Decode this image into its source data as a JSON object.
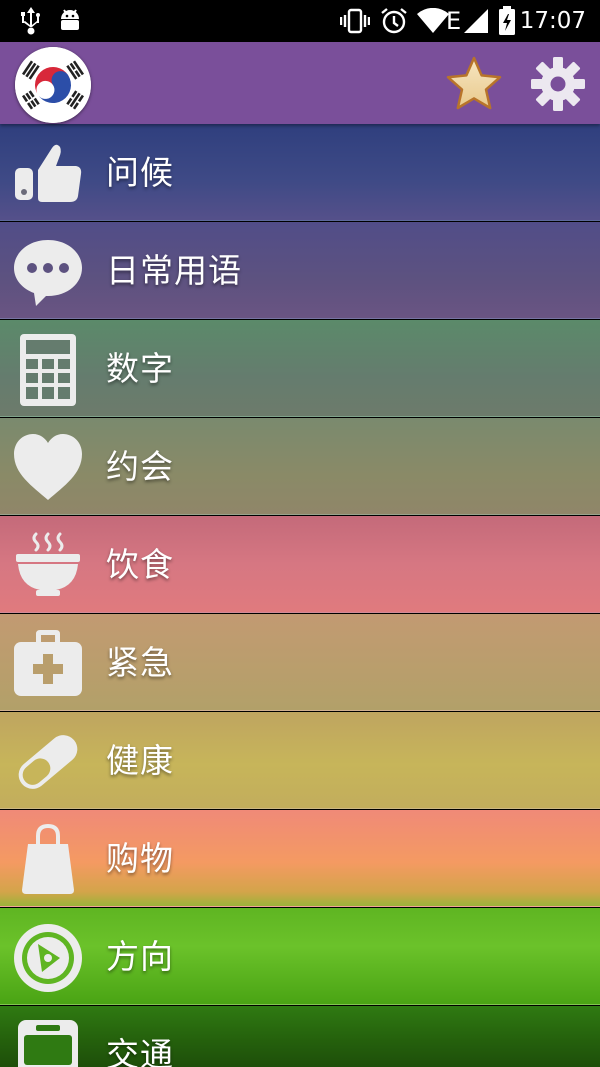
{
  "status_bar": {
    "time": "17:07",
    "left_icons": [
      "usb-icon",
      "android-debug-icon"
    ],
    "right_icons": [
      "vibrate-icon",
      "alarm-icon",
      "wifi-icon",
      "network-e-icon",
      "signal-icon",
      "battery-charging-icon"
    ],
    "network_type": "E"
  },
  "app_bar": {
    "flag_icon": "korea-flag-icon",
    "actions": [
      "favorites-star-icon",
      "settings-gear-icon"
    ],
    "accent_color": "#7a4f9a"
  },
  "categories": [
    {
      "label": "问候",
      "icon": "thumbs-up-icon"
    },
    {
      "label": "日常用语",
      "icon": "chat-bubble-icon"
    },
    {
      "label": "数字",
      "icon": "calculator-icon"
    },
    {
      "label": "约会",
      "icon": "heart-icon"
    },
    {
      "label": "饮食",
      "icon": "bowl-icon"
    },
    {
      "label": "紧急",
      "icon": "first-aid-kit-icon"
    },
    {
      "label": "健康",
      "icon": "pill-icon"
    },
    {
      "label": "购物",
      "icon": "shopping-bag-icon"
    },
    {
      "label": "方向",
      "icon": "compass-icon"
    },
    {
      "label": "交通",
      "icon": "bus-icon"
    }
  ]
}
